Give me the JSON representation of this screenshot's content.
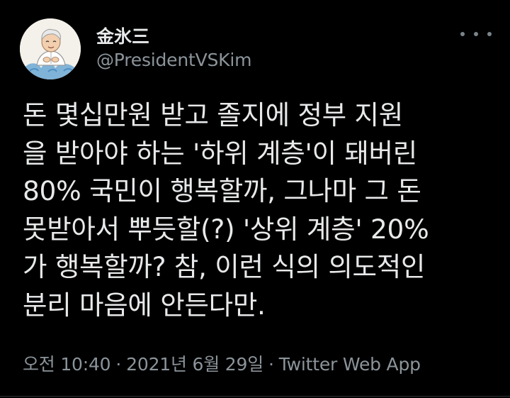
{
  "author": {
    "display_name": "金氷三",
    "handle": "@PresidentVSKim"
  },
  "more_icon": "ellipsis-horizontal-icon",
  "tweet": {
    "lines": [
      "돈 몇십만원 받고 졸지에 정부 지원",
      "을 받아야 하는 '하위 계층'이 돼버린",
      "80% 국민이 행복할까, 그나마 그 돈",
      "못받아서 뿌듯할(?) '상위 계층' 20%",
      "가 행복할까? 참, 이런 식의 의도적인",
      "분리 마음에 안든다만."
    ]
  },
  "meta": {
    "time": "오전 10:40",
    "separator": "·",
    "date": "2021년 6월 29일",
    "source": "Twitter Web App"
  },
  "colors": {
    "background": "#000000",
    "primary_text": "#e7e9ea",
    "secondary_text": "#8b949a",
    "avatar_background": "#f4f1ea"
  }
}
